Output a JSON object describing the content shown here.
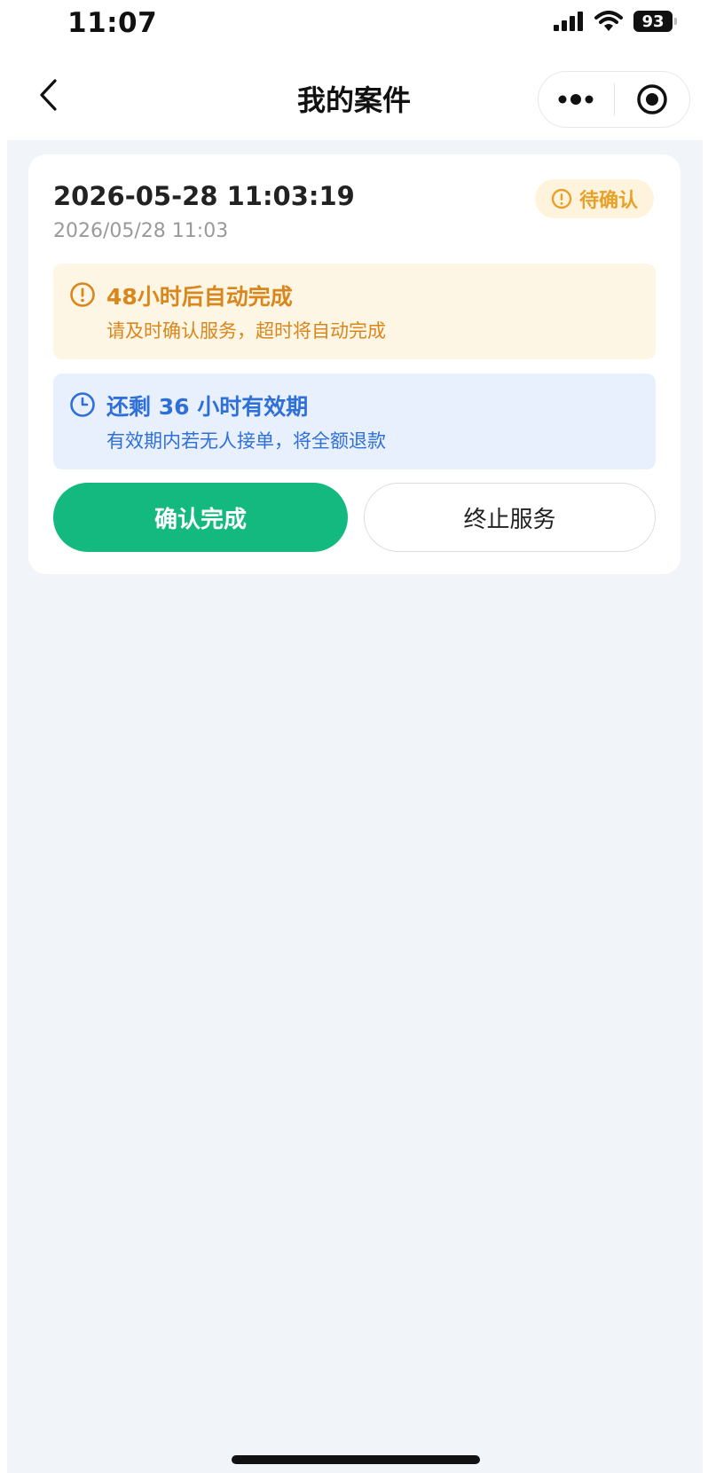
{
  "status_bar": {
    "time": "11:07",
    "battery": "93",
    "icons": [
      "signal-icon",
      "wifi-icon",
      "battery-icon"
    ]
  },
  "nav": {
    "title": "我的案件",
    "back_icon": "chevron-left-icon",
    "more_icon": "more-dots-icon",
    "close_icon": "target-circle-icon"
  },
  "case_card": {
    "datetime": "2026-05-28 11:03:19",
    "subdate": "2026/05/28 11:03",
    "status_badge": {
      "label": "待确认",
      "icon": "exclamation-circle-icon",
      "color": "#e7a028"
    },
    "warning_notice": {
      "title": "48小时后自动完成",
      "text": "请及时确认服务，超时将自动完成",
      "icon": "exclamation-circle-icon",
      "color": "#d9861d"
    },
    "info_notice": {
      "title": "还剩 36 小时有效期",
      "text": "有效期内若无人接单，将全额退款",
      "icon": "clock-icon",
      "color": "#2f6fd8"
    },
    "buttons": {
      "confirm_label": "确认完成",
      "terminate_label": "终止服务"
    }
  },
  "colors": {
    "accent_green": "#13b97e",
    "page_background": "#f1f5f9"
  }
}
